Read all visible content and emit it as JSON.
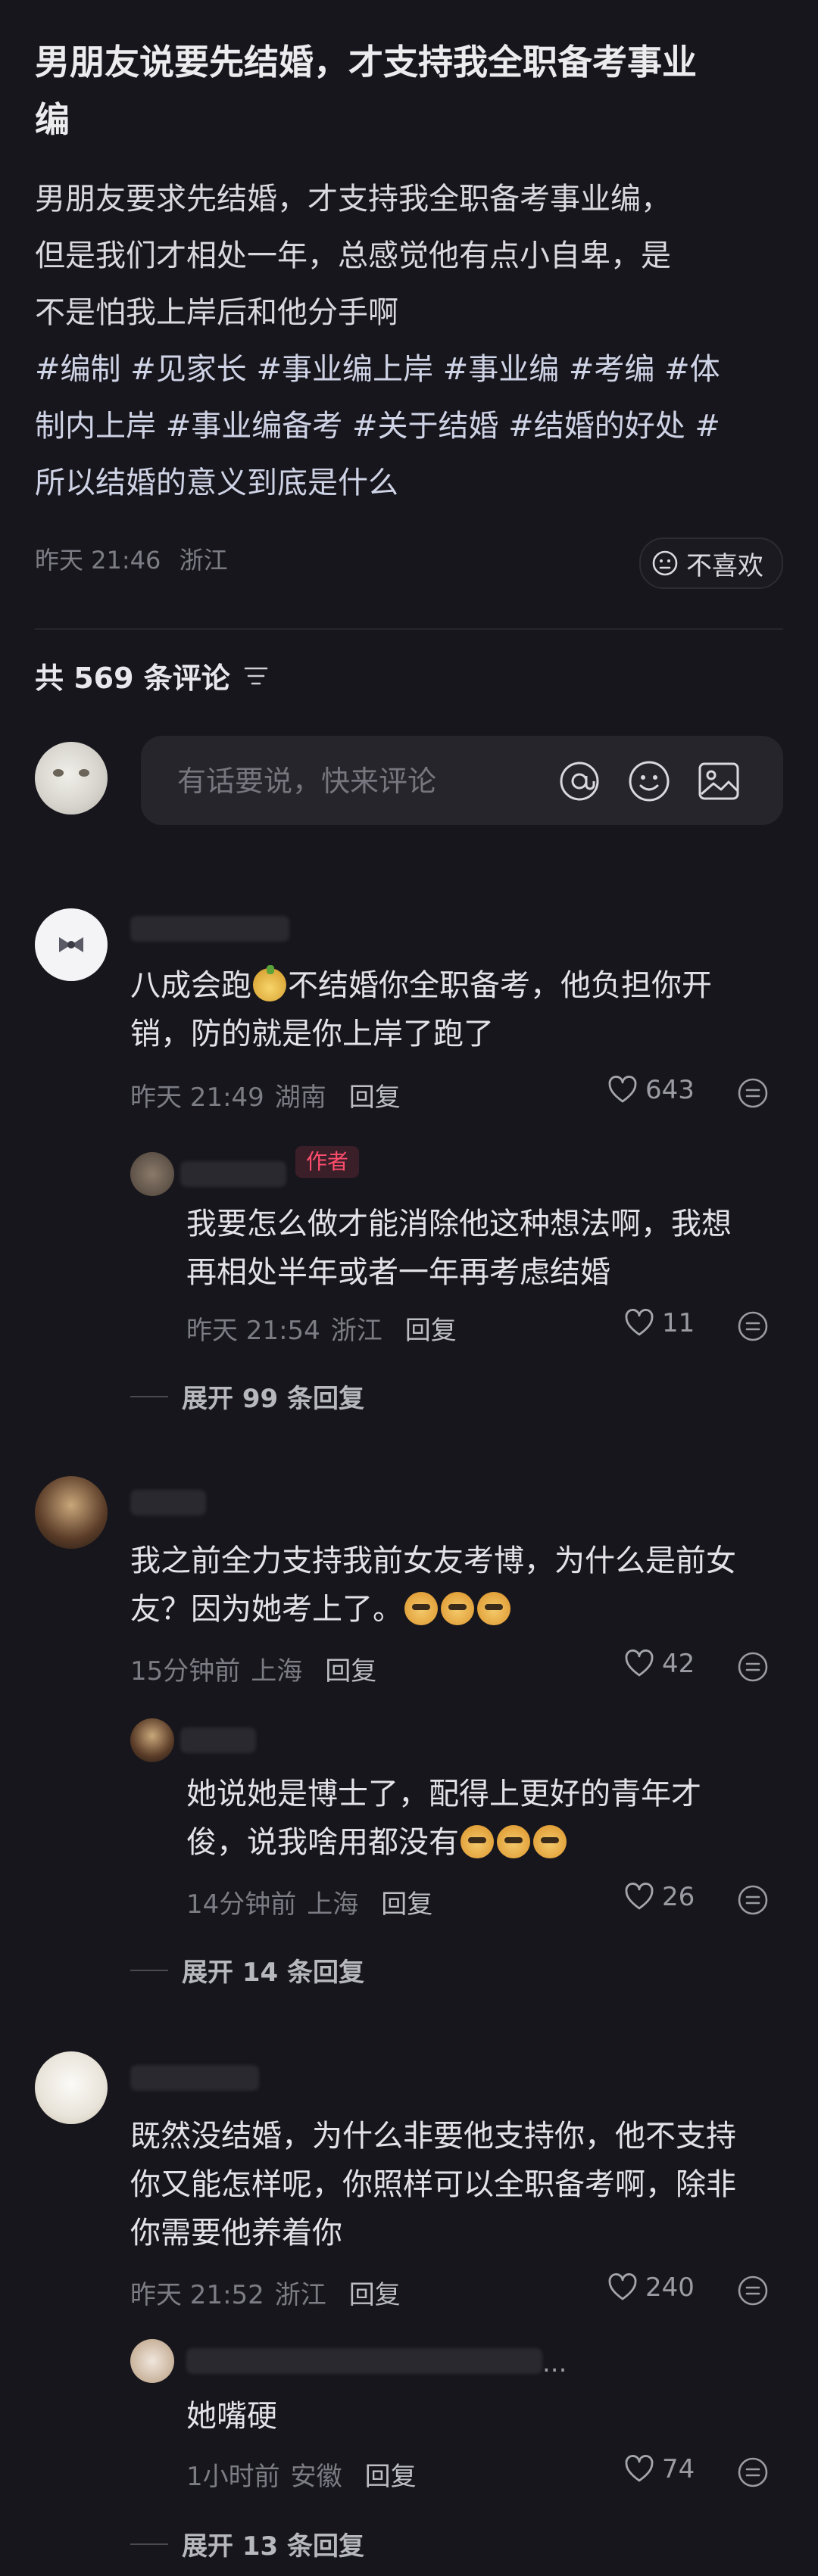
{
  "post": {
    "title_line1": "男朋友说要先结婚，才支持我全职备考事业",
    "title_line2": "编",
    "body_line1": "男朋友要求先结婚，才支持我全职备考事业编，",
    "body_line2": "但是我们才相处一年，总感觉他有点小自卑，是",
    "body_line3": "不是怕我上岸后和他分手啊",
    "tags_line1": "#编制 #见家长 #事业编上岸 #事业编 #考编 #体",
    "tags_line2": "制内上岸 #事业编备考 #关于结婚 #结婚的好处 #",
    "tags_line3": "所以结婚的意义到底是什么",
    "time": "昨天 21:46",
    "location": "浙江",
    "dislike_label": "不喜欢"
  },
  "comments_header": {
    "count_label": "共 569 条评论",
    "sort_icon": "sort-icon"
  },
  "composer": {
    "placeholder": "有话要说，快来评论",
    "icons": [
      "at-icon",
      "emoji-icon",
      "image-icon"
    ]
  },
  "comments": [
    {
      "text_line1": "八成会跑",
      "text_line1b": "不结婚你全职备考，他负担你开",
      "text_line2": "销，防的就是你上岸了跑了",
      "time": "昨天 21:49",
      "location": "湖南",
      "reply": "回复",
      "likes": "643",
      "replies": [
        {
          "badge": "作者",
          "text_line1": "我要怎么做才能消除他这种想法啊，我想",
          "text_line2": "再相处半年或者一年再考虑结婚",
          "time": "昨天 21:54",
          "location": "浙江",
          "reply": "回复",
          "likes": "11"
        }
      ],
      "expand": "展开 99 条回复"
    },
    {
      "text_line1": "我之前全力支持我前女友考博，为什么是前女",
      "text_line2": "友？因为她考上了。",
      "time": "15分钟前",
      "location": "上海",
      "reply": "回复",
      "likes": "42",
      "replies": [
        {
          "text_line1": "她说她是博士了，配得上更好的青年才",
          "text_line2": "俊，说我啥用都没有",
          "time": "14分钟前",
          "location": "上海",
          "reply": "回复",
          "likes": "26"
        }
      ],
      "expand": "展开 14 条回复"
    },
    {
      "text_line1": "既然没结婚，为什么非要他支持你，他不支持",
      "text_line2": "你又能怎样呢，你照样可以全职备考啊，除非",
      "text_line3": "你需要他养着你",
      "time": "昨天 21:52",
      "location": "浙江",
      "reply": "回复",
      "likes": "240",
      "replies": [
        {
          "nick_tail": "...",
          "text_line1": "她嘴硬",
          "time": "1小时前",
          "location": "安徽",
          "reply": "回复",
          "likes": "74"
        }
      ],
      "expand": "展开 13 条回复"
    }
  ]
}
